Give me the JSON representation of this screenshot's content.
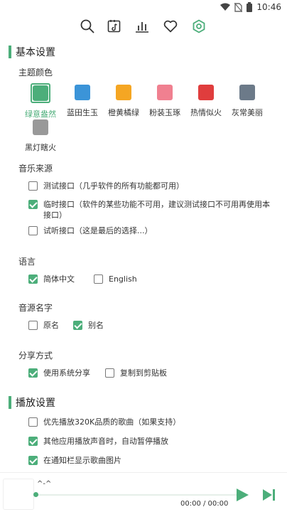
{
  "status_bar": {
    "time": "10:46"
  },
  "nav": {
    "items": [
      {
        "name": "search-icon"
      },
      {
        "name": "music-list-icon"
      },
      {
        "name": "leaderboard-icon"
      },
      {
        "name": "favorites-heart-icon"
      },
      {
        "name": "settings-gear-icon",
        "active": true
      }
    ],
    "active_color": "#4cae7a"
  },
  "basic_settings": {
    "heading": "基本设置",
    "theme": {
      "label": "主题颜色",
      "options": [
        {
          "name": "绿意盎然",
          "color": "#4cae7a",
          "selected": true
        },
        {
          "name": "蓝田生玉",
          "color": "#3b94d8"
        },
        {
          "name": "橙黄橘绿",
          "color": "#f5a623"
        },
        {
          "name": "粉装玉琢",
          "color": "#f08090"
        },
        {
          "name": "热情似火",
          "color": "#e03d3d"
        },
        {
          "name": "灰常美丽",
          "color": "#6c7a89"
        },
        {
          "name": "黑灯瞎火",
          "color": "#999999"
        }
      ]
    },
    "music_source": {
      "label": "音乐来源",
      "options": [
        {
          "text": "测试接口（几乎软件的所有功能都可用）",
          "checked": false
        },
        {
          "text": "临时接口（软件的某些功能不可用，建议测试接口不可用再使用本接口）",
          "checked": true
        },
        {
          "text": "试听接口（这是最后的选择...）",
          "checked": false
        }
      ]
    },
    "language": {
      "label": "语言",
      "options": [
        {
          "text": "简体中文",
          "checked": true
        },
        {
          "text": "English",
          "checked": false
        }
      ]
    },
    "source_name": {
      "label": "音源名字",
      "options": [
        {
          "text": "原名",
          "checked": false
        },
        {
          "text": "别名",
          "checked": true
        }
      ]
    },
    "share": {
      "label": "分享方式",
      "options": [
        {
          "text": "使用系统分享",
          "checked": true
        },
        {
          "text": "复制到剪贴板",
          "checked": false
        }
      ]
    }
  },
  "playback_settings": {
    "heading": "播放设置",
    "options": [
      {
        "text": "优先播放320K品质的歌曲（如果支持）",
        "checked": false
      },
      {
        "text": "其他应用播放声音时，自动暂停播放",
        "checked": true
      },
      {
        "text": "在通知栏显示歌曲图片",
        "checked": true
      }
    ]
  },
  "player": {
    "title": "^-^",
    "time": "00:00 / 00:00",
    "progress": 0
  }
}
